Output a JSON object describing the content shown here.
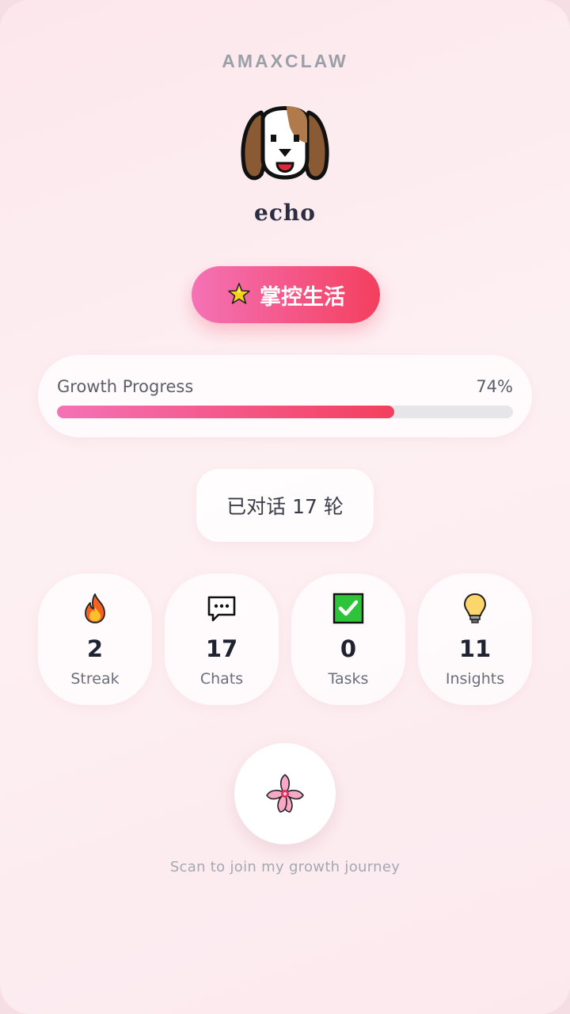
{
  "brand": "AMAXCLAW",
  "profile": {
    "name": "echo",
    "avatar_icon": "beagle-dog-icon"
  },
  "title_badge": {
    "icon": "sparkle-star-icon",
    "label": "掌控生活"
  },
  "progress": {
    "label": "Growth Progress",
    "percent_text": "74%",
    "value": 0.74
  },
  "conversation": {
    "text": "已对话 17 轮"
  },
  "stats": [
    {
      "icon": "fire-icon",
      "value": "2",
      "label": "Streak"
    },
    {
      "icon": "speech-bubble-icon",
      "value": "17",
      "label": "Chats"
    },
    {
      "icon": "check-box-icon",
      "value": "0",
      "label": "Tasks"
    },
    {
      "icon": "light-bulb-icon",
      "value": "11",
      "label": "Insights"
    }
  ],
  "qr": {
    "icon": "cherry-blossom-icon",
    "caption": "Scan to join my growth journey"
  },
  "colors": {
    "accent_start": "#f472b6",
    "accent_end": "#f43f5e",
    "background": "#fce7ec"
  }
}
